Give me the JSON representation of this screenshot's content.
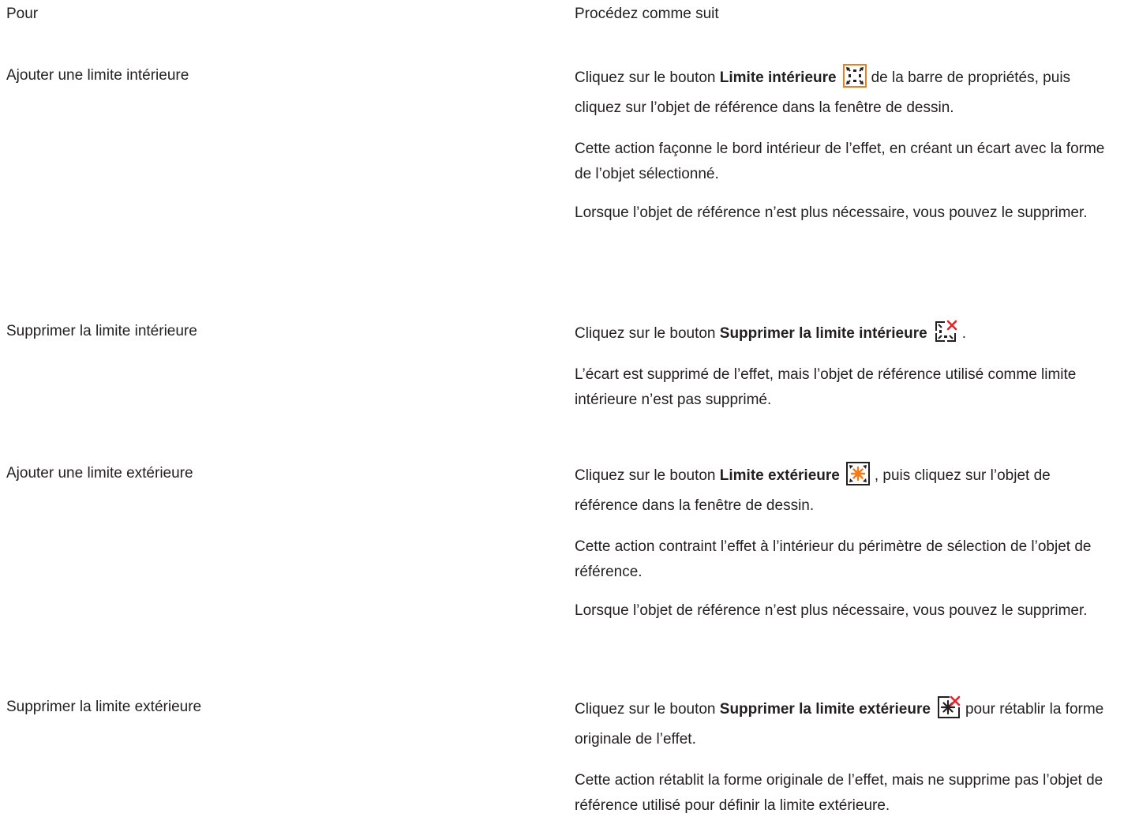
{
  "headers": {
    "task": "Pour",
    "procedure": "Procédez comme suit"
  },
  "rows": [
    {
      "task": "Ajouter une limite intérieure",
      "p1_before": "Cliquez sur le bouton",
      "p1_bold": "Limite intérieure",
      "p1_icon": "add-inner-boundary-icon",
      "p1_after": "de la barre de propriétés, puis cliquez sur l’objet de référence dans la fenêtre de dessin.",
      "p2": "Cette action façonne le bord intérieur de l’effet, en créant un écart avec la forme de l’objet sélectionné.",
      "p3": "Lorsque l’objet de référence n’est plus nécessaire, vous pouvez le supprimer."
    },
    {
      "task": "Supprimer la limite intérieure",
      "p1_before": "Cliquez sur le bouton",
      "p1_bold": "Supprimer la limite intérieure",
      "p1_icon": "remove-inner-boundary-icon",
      "p1_after": ".",
      "p2": "L’écart est supprimé de l’effet, mais l’objet de référence utilisé comme limite intérieure n’est pas supprimé."
    },
    {
      "task": "Ajouter une limite extérieure",
      "p1_before": "Cliquez sur le bouton",
      "p1_bold": "Limite extérieure",
      "p1_icon": "add-outer-boundary-icon",
      "p1_after": ", puis cliquez sur l’objet de référence dans la fenêtre de dessin.",
      "p2": "Cette action contraint l’effet à l’intérieur du périmètre de sélection de l’objet de référence.",
      "p3": "Lorsque l’objet de référence n’est plus nécessaire, vous pouvez le supprimer."
    },
    {
      "task": "Supprimer la limite extérieure",
      "p1_before": "Cliquez sur le bouton",
      "p1_bold": "Supprimer la limite extérieure",
      "p1_icon": "remove-outer-boundary-icon",
      "p1_after": "pour rétablir la forme originale de l’effet.",
      "p2": "Cette action rétablit la forme originale de l’effet, mais ne supprime pas l’objet de référence utilisé pour définir la limite extérieure."
    }
  ],
  "colors": {
    "text": "#231f20",
    "icon_accent": "#f07c1a",
    "icon_remove": "#e8202a"
  }
}
